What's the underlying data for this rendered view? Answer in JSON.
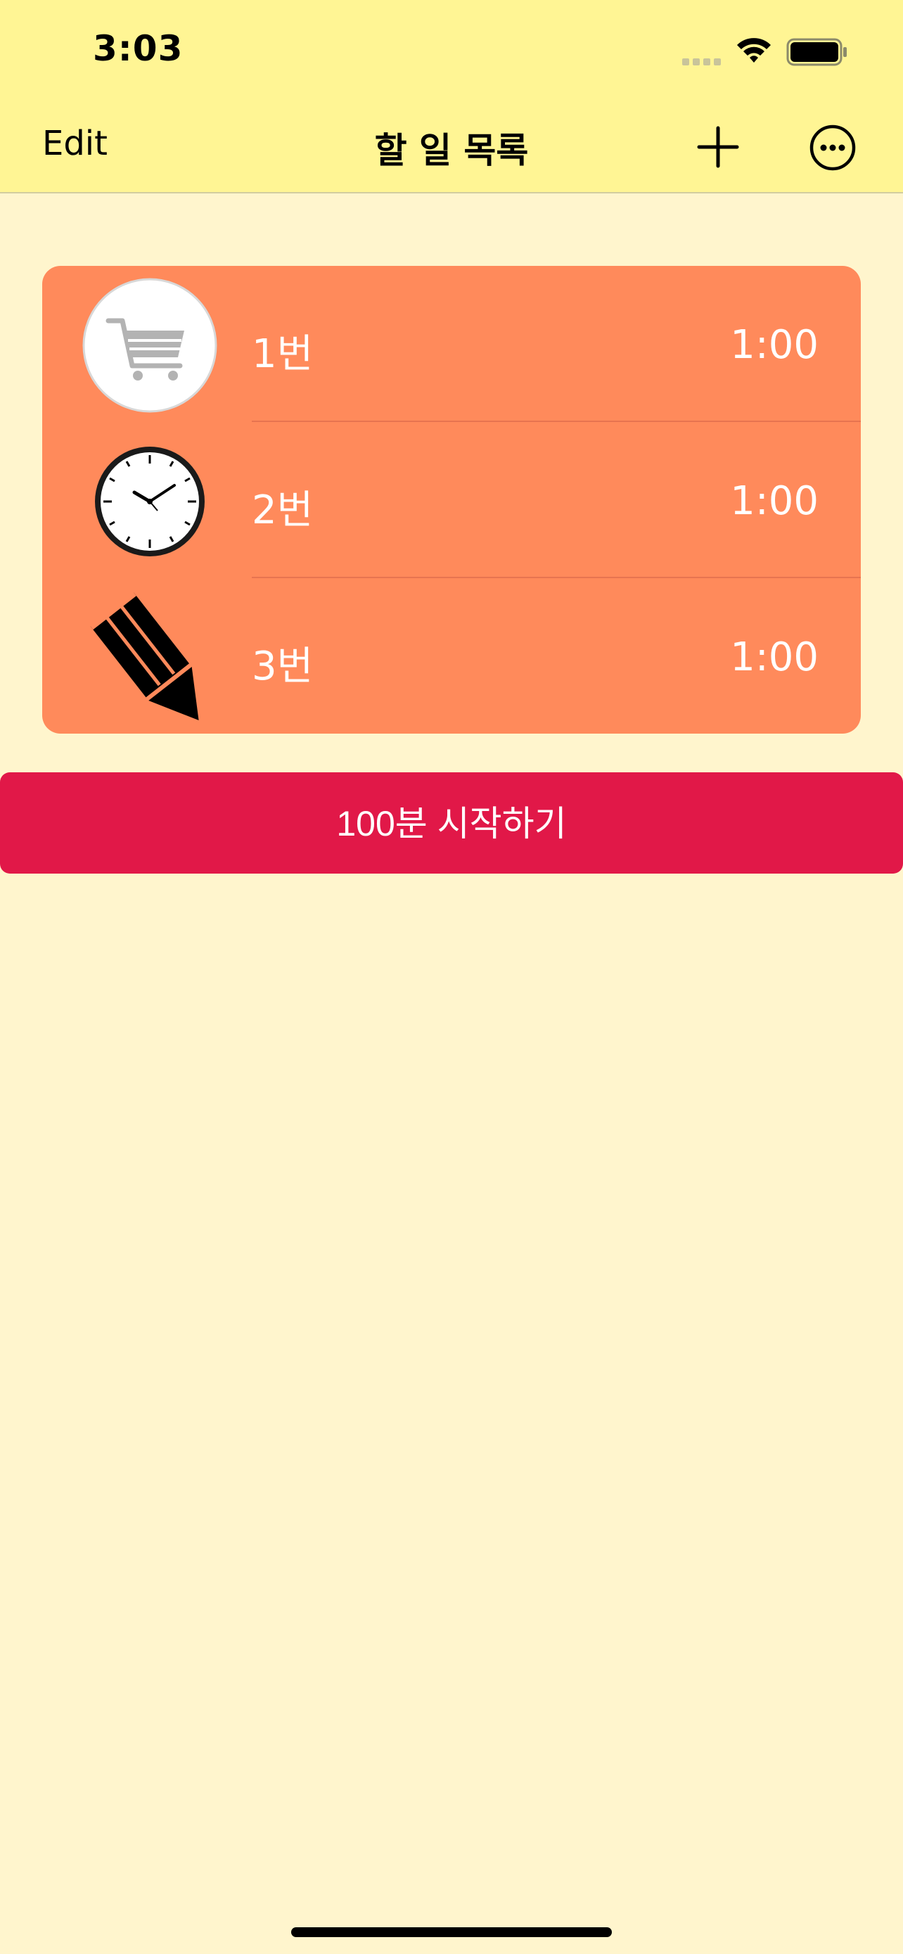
{
  "status_bar": {
    "time": "3:03"
  },
  "nav": {
    "edit_label": "Edit",
    "title": "할 일 목록"
  },
  "tasks": [
    {
      "label": "1번",
      "duration": "1:00",
      "icon": "cart-icon"
    },
    {
      "label": "2번",
      "duration": "1:00",
      "icon": "clock-icon"
    },
    {
      "label": "3번",
      "duration": "1:00",
      "icon": "pencil-icon"
    }
  ],
  "start_button": {
    "label": "100분 시작하기"
  },
  "colors": {
    "header": "#FFF594",
    "background": "#FFF5CD",
    "card": "#FF8A5B",
    "button": "#E11848"
  }
}
